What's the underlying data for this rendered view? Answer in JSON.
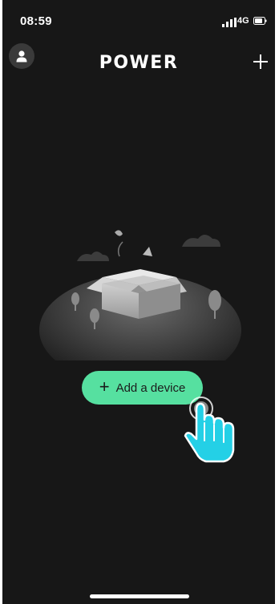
{
  "status_bar": {
    "time": "08:59",
    "network": "4G",
    "signal_icon": "signal-bars-icon",
    "battery_icon": "battery-icon"
  },
  "header": {
    "title": "POWER",
    "profile_icon": "user-icon",
    "add_icon": "plus-icon"
  },
  "main": {
    "empty_state_icon": "open-box-icon",
    "add_device_label": "Add a device",
    "add_device_icon": "plus-icon",
    "pointer_icon": "tap-hand-icon"
  },
  "colors": {
    "background": "#171717",
    "accent": "#56e0a0",
    "pointer": "#24d0e6"
  }
}
